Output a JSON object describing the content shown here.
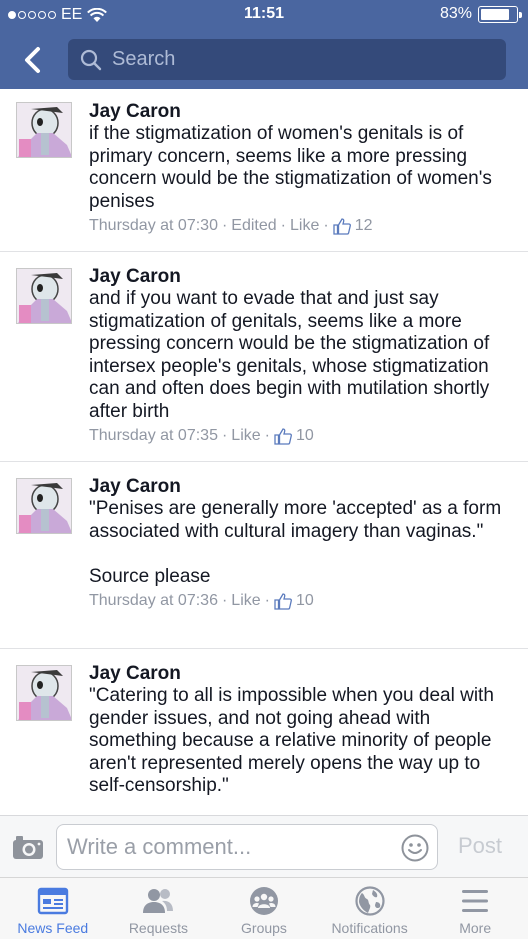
{
  "status": {
    "carrier": "EE",
    "time": "11:51",
    "battery": "83%",
    "battery_level": 0.83,
    "signal_bars": 1
  },
  "header": {
    "search_placeholder": "Search",
    "back_icon": "chevron-left-icon",
    "search_icon": "search-icon"
  },
  "comments": [
    {
      "author": "Jay Caron",
      "text": "if the stigmatization of women's genitals is of primary concern, seems like a more pressing concern would be the stigmatization of women's penises",
      "time": "Thursday at 07:30",
      "edited": "Edited",
      "like_label": "Like",
      "likes": "12"
    },
    {
      "author": "Jay Caron",
      "text": "and if you want to evade that and just say stigmatization of genitals, seems like a more pressing concern would be the stigmatization of intersex people's genitals, whose stigmatization can and often does begin with mutilation shortly after birth",
      "time": "Thursday at 07:35",
      "like_label": "Like",
      "likes": "10"
    },
    {
      "author": "Jay Caron",
      "text": "\"Penises are generally more 'accepted' as a form associated with cultural imagery than vaginas.\"\n\nSource please",
      "time": "Thursday at 07:36",
      "like_label": "Like",
      "likes": "10"
    },
    {
      "author": "Jay Caron",
      "text": "\"Catering to all is impossible when you deal with gender issues, and not going ahead with something because a relative minority of people aren't represented merely opens the way up to self-censorship.\"",
      "time": "",
      "like_label": "",
      "likes": ""
    }
  ],
  "composer": {
    "placeholder": "Write a comment...",
    "post_label": "Post"
  },
  "tabs": [
    {
      "label": "News Feed",
      "icon": "news-feed-icon",
      "active": true
    },
    {
      "label": "Requests",
      "icon": "friend-requests-icon",
      "active": false
    },
    {
      "label": "Groups",
      "icon": "groups-icon",
      "active": false
    },
    {
      "label": "Notifications",
      "icon": "globe-icon",
      "active": false
    },
    {
      "label": "More",
      "icon": "menu-icon",
      "active": false
    }
  ],
  "colors": {
    "header_bg": "#4a66a0",
    "search_bg": "#344a7a",
    "active_tab": "#4a7be0",
    "meta_text": "#9197a3"
  }
}
